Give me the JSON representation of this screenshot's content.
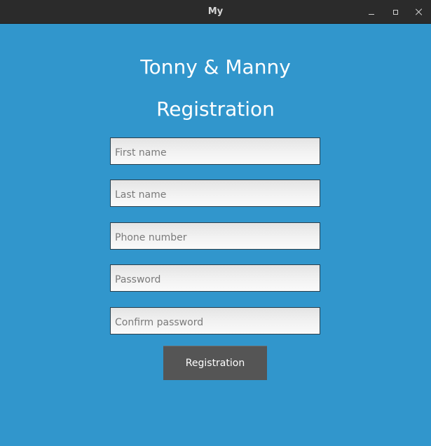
{
  "window": {
    "title": "My",
    "controls": {
      "minimize": "minimize-icon",
      "maximize": "maximize-icon",
      "close": "close-icon"
    }
  },
  "form": {
    "title_line1": "Tonny & Manny",
    "title_line2": "Registration",
    "fields": {
      "first_name": {
        "placeholder": "First name",
        "value": ""
      },
      "last_name": {
        "placeholder": "Last name",
        "value": ""
      },
      "phone_number": {
        "placeholder": "Phone number",
        "value": ""
      },
      "password": {
        "placeholder": "Password",
        "value": ""
      },
      "confirm_password": {
        "placeholder": "Confirm password",
        "value": ""
      }
    },
    "submit_label": "Registration"
  },
  "colors": {
    "background": "#3196cc",
    "titlebar": "#2b2b2b",
    "button": "#555555",
    "heading_text": "#ffffff"
  }
}
